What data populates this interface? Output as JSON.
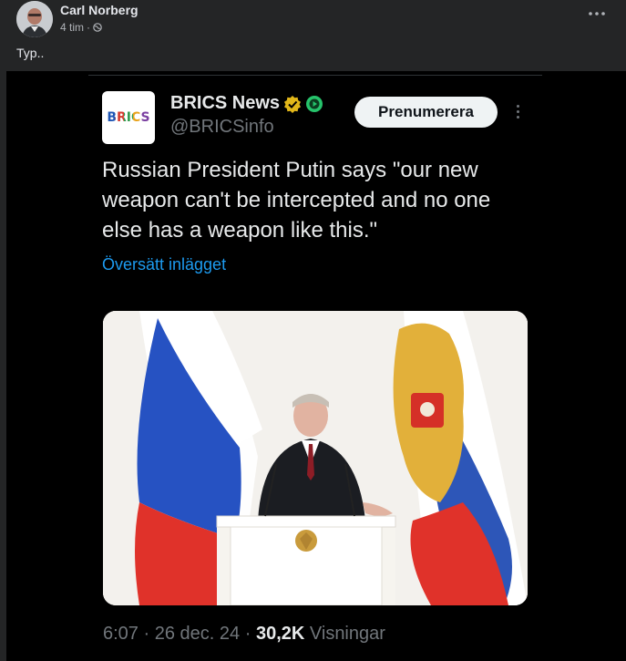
{
  "post": {
    "author": "Carl Norberg",
    "time": "4 tim",
    "separator": "·",
    "caption": "Typ..",
    "more_icon": "more-dots-icon",
    "privacy_icon": "globe-icon"
  },
  "tweet": {
    "logo_text": "BRICS",
    "account_name": "BRICS News",
    "handle": "@BRICSinfo",
    "subscribe_label": "Prenumerera",
    "text": "Russian President Putin says \"our new weapon can't be intercepted and no one else has a weapon like this.\"",
    "translate_label": "Översätt inlägget",
    "time": "6:07",
    "date": "26 dec. 24",
    "views_count": "30,2K",
    "views_label": "Visningar",
    "dot": "·"
  },
  "colors": {
    "fb_background": "#242526",
    "tweet_background": "#000000",
    "link_blue": "#1d9bf0",
    "verified_gold": "#e2b719",
    "subscribe_bg": "#eff3f4"
  }
}
